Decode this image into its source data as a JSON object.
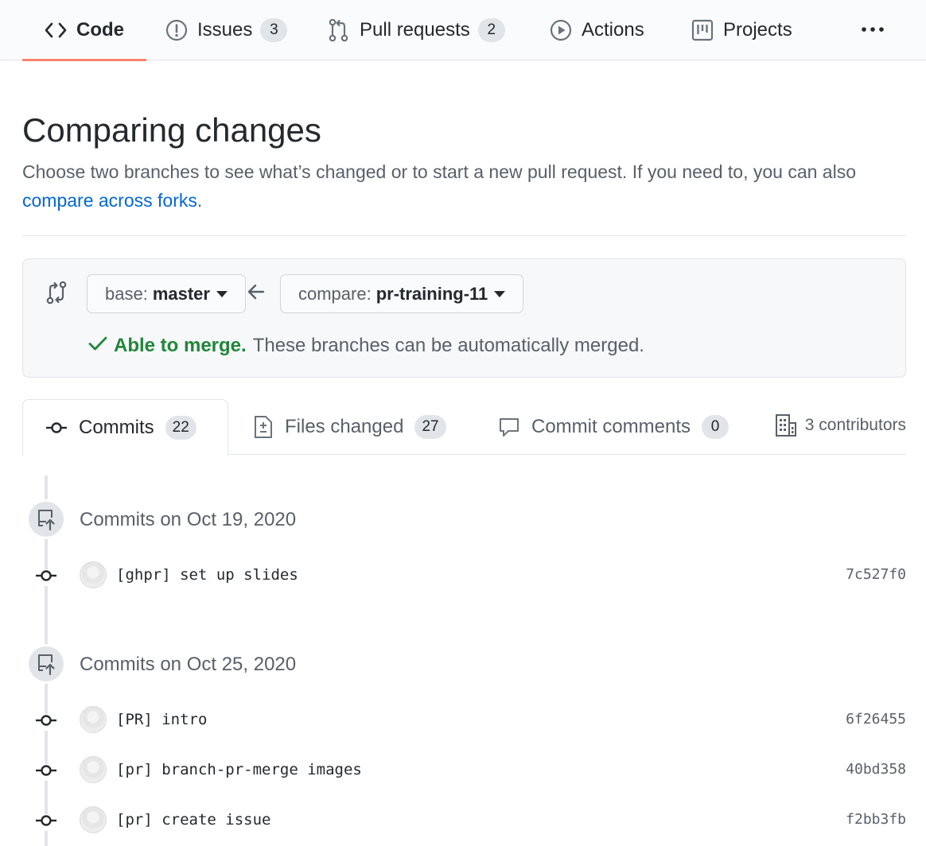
{
  "nav": {
    "tabs": [
      {
        "label": "Code",
        "icon": "code-icon",
        "selected": true
      },
      {
        "label": "Issues",
        "icon": "issue-opened-icon",
        "count": "3"
      },
      {
        "label": "Pull requests",
        "icon": "git-pull-request-icon",
        "count": "2"
      },
      {
        "label": "Actions",
        "icon": "play-icon"
      },
      {
        "label": "Projects",
        "icon": "project-icon"
      }
    ],
    "more_icon": "kebab-horizontal-icon",
    "selected_underline_color": "#f9826c"
  },
  "page": {
    "title": "Comparing changes",
    "description": "Choose two branches to see what’s changed or to start a new pull request. If you need to, you can also ",
    "link_text": "compare across forks",
    "link_suffix": ".",
    "link_color": "#0366d6"
  },
  "range": {
    "icon": "git-compare-icon",
    "base_label": "base:",
    "base_value": "master",
    "arrow_icon": "arrow-left-icon",
    "compare_label": "compare:",
    "compare_value": "pr-training-11",
    "merge_ok": "Able to merge.",
    "merge_text": "These branches can be automatically merged.",
    "merge_color": "#22863a"
  },
  "tabs": {
    "commits": {
      "label": "Commits",
      "count": "22"
    },
    "files": {
      "label": "Files changed",
      "count": "27"
    },
    "comments": {
      "label": "Commit comments",
      "count": "0"
    },
    "contributors": "3 contributors"
  },
  "groups": [
    {
      "title": "Commits on Oct 19, 2020",
      "commits": [
        {
          "message": "[ghpr] set up slides",
          "sha": "7c527f0"
        }
      ]
    },
    {
      "title": "Commits on Oct 25, 2020",
      "commits": [
        {
          "message": "[PR] intro",
          "sha": "6f26455"
        },
        {
          "message": "[pr] branch-pr-merge images",
          "sha": "40bd358"
        },
        {
          "message": "[pr] create issue",
          "sha": "f2bb3fb"
        }
      ]
    }
  ]
}
